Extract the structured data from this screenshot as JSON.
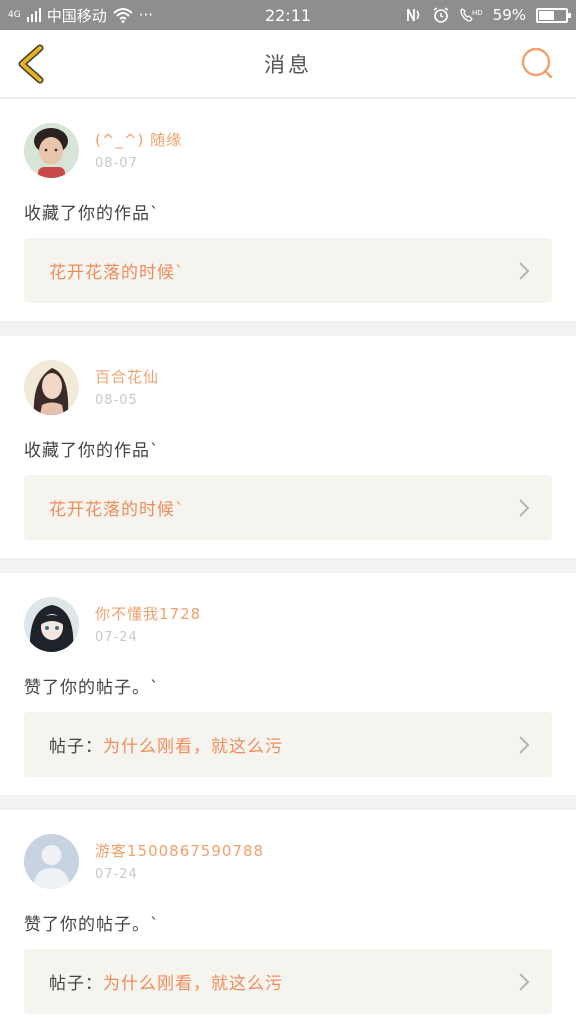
{
  "status_bar": {
    "network": "4G",
    "carrier": "中国移动",
    "more": "···",
    "time": "22:11",
    "battery_text": "59%",
    "battery_level": 0.59
  },
  "header": {
    "title": "消息"
  },
  "messages": [
    {
      "user": "(^_^) 随缘",
      "date": "08-07",
      "action": "收藏了你的作品`",
      "ref_prefix": "",
      "ref_title": "花开花落的时候`"
    },
    {
      "user": "百合花仙",
      "date": "08-05",
      "action": "收藏了你的作品`",
      "ref_prefix": "",
      "ref_title": "花开花落的时候`"
    },
    {
      "user": "你不懂我1728",
      "date": "07-24",
      "action": "赞了你的帖子。`",
      "ref_prefix": "帖子：",
      "ref_title": "为什么刚看，就这么污"
    },
    {
      "user": "游客1500867590788",
      "date": "07-24",
      "action": "赞了你的帖子。`",
      "ref_prefix": "帖子：",
      "ref_title": "为什么刚看，就这么污"
    }
  ],
  "colors": {
    "accent": "#ef8d5c",
    "back_icon": "#e8b21e"
  }
}
